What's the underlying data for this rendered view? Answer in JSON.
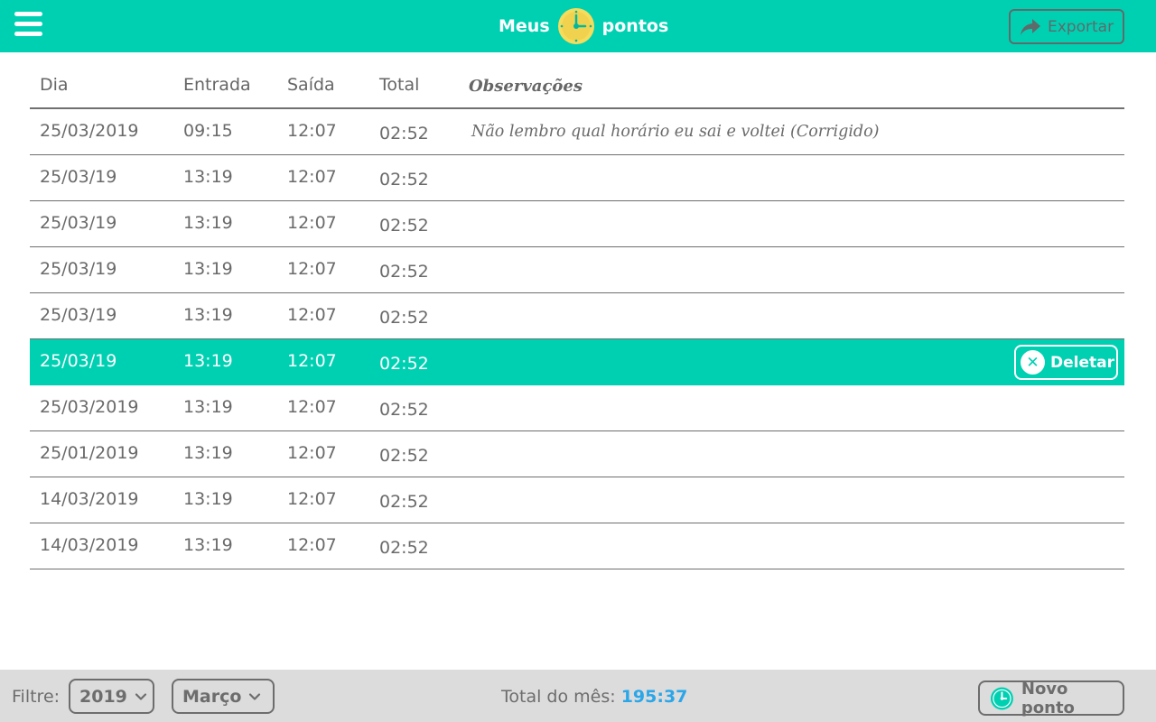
{
  "header": {
    "title_left": "Meus",
    "title_right": "pontos",
    "export_label": "Exportar"
  },
  "table": {
    "columns": [
      "Dia",
      "Entrada",
      "Saída",
      "Total",
      "Observações"
    ],
    "rows": [
      {
        "dia": "25/03/2019",
        "entrada": "09:15",
        "saida": "12:07",
        "total": "02:52",
        "obs": "Não lembro qual horário eu sai e voltei (Corrigido)"
      },
      {
        "dia": "25/03/19",
        "entrada": "13:19",
        "saida": "12:07",
        "total": "02:52",
        "obs": ""
      },
      {
        "dia": "25/03/19",
        "entrada": "13:19",
        "saida": "12:07",
        "total": "02:52",
        "obs": ""
      },
      {
        "dia": "25/03/19",
        "entrada": "13:19",
        "saida": "12:07",
        "total": "02:52",
        "obs": ""
      },
      {
        "dia": "25/03/19",
        "entrada": "13:19",
        "saida": "12:07",
        "total": "02:52",
        "obs": ""
      },
      {
        "dia": "25/03/19",
        "entrada": "13:19",
        "saida": "12:07",
        "total": "02:52",
        "obs": "",
        "selected": true
      },
      {
        "dia": "25/03/2019",
        "entrada": "13:19",
        "saida": "12:07",
        "total": "02:52",
        "obs": ""
      },
      {
        "dia": "25/01/2019",
        "entrada": "13:19",
        "saida": "12:07",
        "total": "02:52",
        "obs": ""
      },
      {
        "dia": "14/03/2019",
        "entrada": "13:19",
        "saida": "12:07",
        "total": "02:52",
        "obs": ""
      },
      {
        "dia": "14/03/2019",
        "entrada": "13:19",
        "saida": "12:07",
        "total": "02:52",
        "obs": ""
      }
    ],
    "delete_label": "Deletar"
  },
  "footer": {
    "filter_label": "Filtre:",
    "year_value": "2019",
    "month_value": "Março",
    "month_total_label": "Total do mês:",
    "month_total_value": "195:37",
    "new_label": "Novo ponto"
  },
  "colors": {
    "accent": "#00d0b2",
    "logo_yellow": "#f6dc5c",
    "total_blue": "#2ba6e8",
    "footer_bg": "#dcdcdc"
  },
  "icons": {
    "menu": "hamburger-icon",
    "logo": "clock-icon",
    "export": "share-arrow-icon",
    "delete": "close-circle-icon",
    "select": "chevron-down-icon",
    "new": "clock-icon"
  }
}
